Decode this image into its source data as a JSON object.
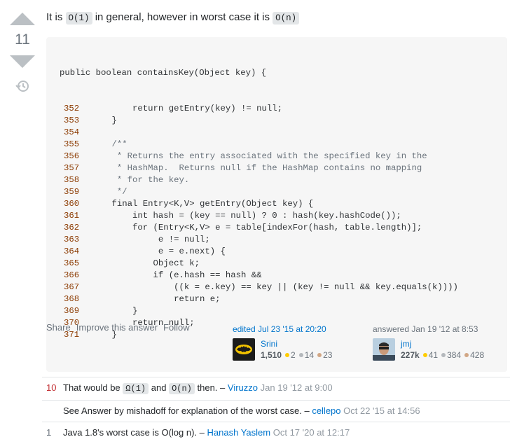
{
  "vote": {
    "count": "11"
  },
  "answer": {
    "intro_prefix": "It is",
    "intro_code1": "O(1)",
    "intro_mid": "in general, however in worst case it is",
    "intro_code2": "O(n)"
  },
  "code": {
    "header": "public boolean containsKey(Object key) {",
    "lines": [
      {
        "n": "352",
        "text": "        return getEntry(key) != null;"
      },
      {
        "n": "353",
        "text": "    }"
      },
      {
        "n": "354",
        "text": ""
      },
      {
        "n": "355",
        "text": "    /**"
      },
      {
        "n": "356",
        "text": "     * Returns the entry associated with the specified key in the"
      },
      {
        "n": "357",
        "text": "     * HashMap.  Returns null if the HashMap contains no mapping"
      },
      {
        "n": "358",
        "text": "     * for the key."
      },
      {
        "n": "359",
        "text": "     */"
      },
      {
        "n": "360",
        "text": "    final Entry<K,V> getEntry(Object key) {"
      },
      {
        "n": "361",
        "text": "        int hash = (key == null) ? 0 : hash(key.hashCode());"
      },
      {
        "n": "362",
        "text": "        for (Entry<K,V> e = table[indexFor(hash, table.length)];"
      },
      {
        "n": "363",
        "text": "             e != null;"
      },
      {
        "n": "364",
        "text": "             e = e.next) {"
      },
      {
        "n": "365",
        "text": "            Object k;"
      },
      {
        "n": "366",
        "text": "            if (e.hash == hash &&"
      },
      {
        "n": "367",
        "text": "                ((k = e.key) == key || (key != null && key.equals(k))))"
      },
      {
        "n": "368",
        "text": "                return e;"
      },
      {
        "n": "369",
        "text": "        }"
      },
      {
        "n": "370",
        "text": "        return null;"
      },
      {
        "n": "371",
        "text": "    }"
      }
    ]
  },
  "post_menu": {
    "share": "Share",
    "improve": "Improve this answer",
    "follow": "Follow"
  },
  "editor": {
    "action": "edited Jul 23 '15 at 20:20",
    "name": "Srini",
    "rep": "1,510",
    "gold": "2",
    "silver": "14",
    "bronze": "23"
  },
  "owner": {
    "action": "answered Jan 19 '12 at 8:53",
    "name": "jmj",
    "rep": "227k",
    "gold": "41",
    "silver": "384",
    "bronze": "428"
  },
  "comments": [
    {
      "score": "10",
      "pre": "That would be",
      "code1": "Ω(1)",
      "mid": "and",
      "code2": "O(n)",
      "post": "then. –",
      "user": "Viruzzo",
      "date": "Jan 19 '12 at 9:00"
    },
    {
      "score": "",
      "text": "See Answer by mishadoff for explanation of the worst case. –",
      "user": "cellepo",
      "date": "Oct 22 '15 at 14:56"
    },
    {
      "score": "1",
      "text": "Java 1.8's worst case is O(log n). –",
      "user": "Hanash Yaslem",
      "date": "Oct 17 '20 at 12:17"
    }
  ]
}
